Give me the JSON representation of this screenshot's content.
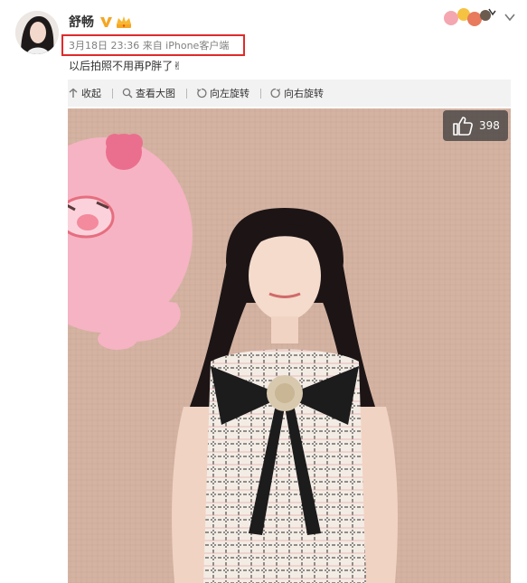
{
  "post": {
    "username": "舒畅",
    "timestamp": "3月18日 23:36 来自 iPhone客户端",
    "text": "以后拍照不用再P胖了✌"
  },
  "toolbar": {
    "collapse": "收起",
    "view_large": "查看大图",
    "rotate_left": "向左旋转",
    "rotate_right": "向右旋转"
  },
  "photo": {
    "like_count": "398"
  },
  "colors": {
    "highlight_border": "#e02a2a",
    "verified_badge": "#f5a623",
    "toolbar_bg": "#f2f2f2"
  },
  "icons": {
    "verified": "verified-v-icon",
    "crown": "crown-icon",
    "chevron": "chevron-down-icon",
    "like": "thumbs-up-icon"
  }
}
